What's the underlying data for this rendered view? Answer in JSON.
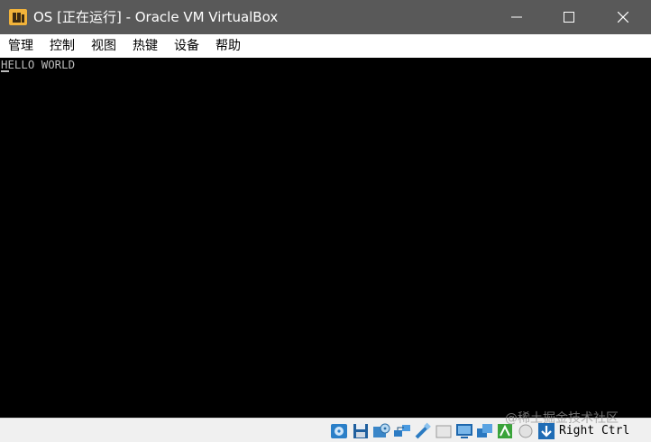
{
  "window": {
    "title": "OS [正在运行] - Oracle VM VirtualBox",
    "app_icon": "virtualbox-logo-icon",
    "controls": [
      "minimize-icon",
      "maximize-icon",
      "close-icon"
    ]
  },
  "menu": {
    "items": [
      "管理",
      "控制",
      "视图",
      "热键",
      "设备",
      "帮助"
    ]
  },
  "console": {
    "text": "HELLO WORLD"
  },
  "statusbar": {
    "icons": [
      "hard-disk-icon",
      "floppy-icon",
      "optical-drive-icon",
      "network-icon",
      "usb-icon",
      "shared-folders-icon",
      "display-icon",
      "video-capture-icon",
      "virtualization-icon",
      "mouse-integration-icon",
      "keyboard-capture-icon"
    ],
    "host_key": "Right Ctrl"
  },
  "watermark": "@稀土掘金技术社区",
  "colors": {
    "titlebar": "#595959",
    "console_bg": "#000000",
    "console_text": "#bcbcbc",
    "statusbar": "#f0f0f0"
  }
}
